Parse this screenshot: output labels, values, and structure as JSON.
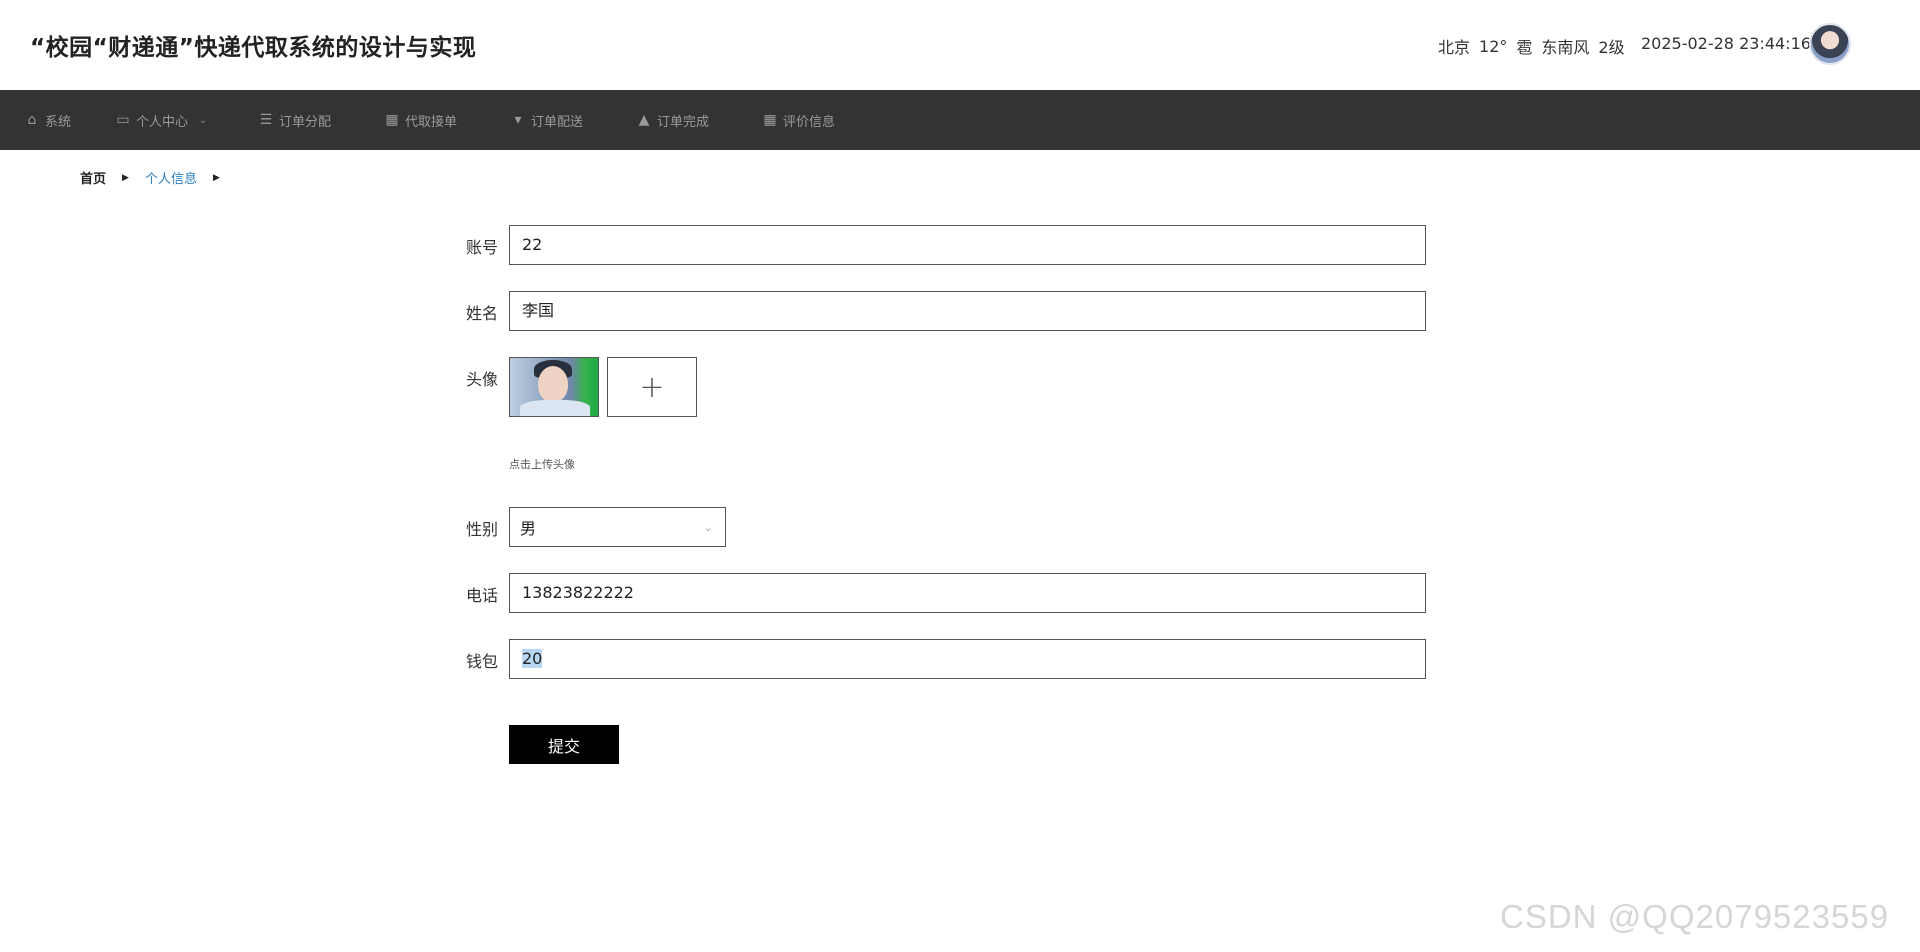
{
  "header": {
    "title": "“校园“财递通”快递代取系统的设计与实现",
    "weather": {
      "city": "北京",
      "temperature": "12°",
      "condition_icon": "雹",
      "wind": "东南风",
      "level": "2级"
    },
    "datetime": "2025-02-28 23:44:16"
  },
  "nav": {
    "items": [
      {
        "label": "系统",
        "icon": "home-icon",
        "glyph": "⌂"
      },
      {
        "label": "个人中心",
        "icon": "card-icon",
        "glyph": "▭",
        "dropdown": true,
        "chevron": "⌄"
      },
      {
        "label": "订单分配",
        "icon": "sliders-icon",
        "glyph": "☰"
      },
      {
        "label": "代取接单",
        "icon": "grid-icon",
        "glyph": "▦"
      },
      {
        "label": "订单配送",
        "icon": "pin-icon",
        "glyph": "▾"
      },
      {
        "label": "订单完成",
        "icon": "thumb-icon",
        "glyph": "▲"
      },
      {
        "label": "评价信息",
        "icon": "apps-icon",
        "glyph": "▦"
      }
    ]
  },
  "breadcrumb": {
    "home": "首页",
    "current": "个人信息",
    "separator": "▶"
  },
  "form": {
    "account": {
      "label": "账号",
      "value": "22"
    },
    "name": {
      "label": "姓名",
      "value": "李国"
    },
    "avatar": {
      "label": "头像",
      "add_glyph": "+",
      "hint": "点击上传头像"
    },
    "gender": {
      "label": "性别",
      "value": "男",
      "chevron": "⌄"
    },
    "phone": {
      "label": "电话",
      "value": "13823822222"
    },
    "wallet": {
      "label": "钱包",
      "value": "20"
    },
    "submit_label": "提交"
  },
  "watermark": "CSDN @QQ2079523559"
}
